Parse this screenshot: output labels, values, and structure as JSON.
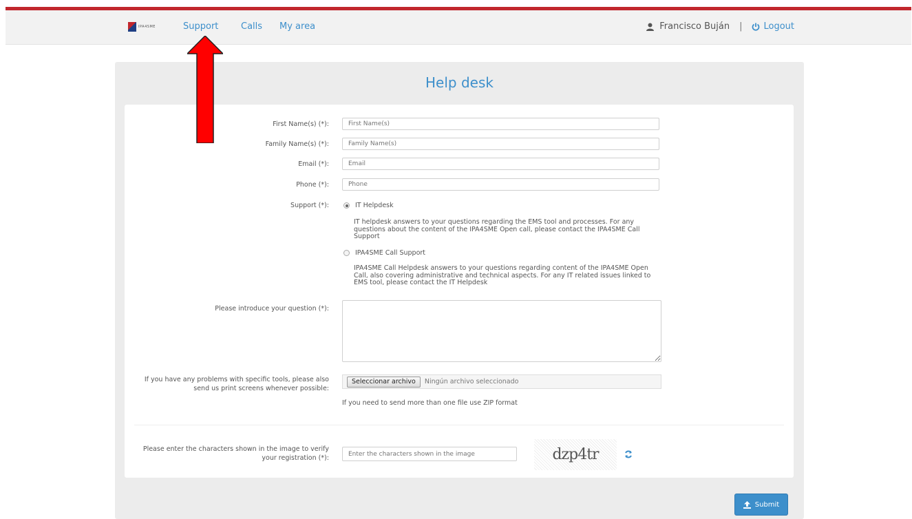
{
  "colors": {
    "accent": "#3d8fcb",
    "top_bar": "#c1272d",
    "arrow": "#ff0000"
  },
  "nav": {
    "logo_text": "IPA4SME",
    "links": [
      "Support",
      "Calls",
      "My area"
    ],
    "user_name": "Francisco Buján",
    "separator": "|",
    "logout_label": "Logout"
  },
  "page": {
    "title": "Help desk"
  },
  "form": {
    "first_name": {
      "label": "First Name(s) (*):",
      "placeholder": "First Name(s)"
    },
    "family_name": {
      "label": "Family Name(s) (*):",
      "placeholder": "Family Name(s)"
    },
    "email": {
      "label": "Email (*):",
      "placeholder": "Email"
    },
    "phone": {
      "label": "Phone (*):",
      "placeholder": "Phone"
    },
    "support": {
      "label": "Support (*):",
      "selected": "IT Helpdesk",
      "options": [
        {
          "label": "IT Helpdesk",
          "description": "IT helpdesk answers to your questions regarding the EMS tool and processes. For any questions about the content of the IPA4SME Open call, please contact the IPA4SME Call Support"
        },
        {
          "label": "IPA4SME Call Support",
          "description": "IPA4SME Call Helpdesk answers to your questions regarding content of the IPA4SME Open Call, also covering administrative and technical aspects. For any IT related issues linked to EMS tool, please contact the IT Helpdesk"
        }
      ]
    },
    "question": {
      "label": "Please introduce your question (*):",
      "value": ""
    },
    "file": {
      "label_line1": "If you have any problems with specific tools, please also",
      "label_line2": "send us print screens whenever possible:",
      "button_label": "Seleccionar archivo",
      "status": "Ningún archivo seleccionado",
      "hint": "If you need to send more than one file use ZIP format"
    },
    "captcha": {
      "label_line1": "Please enter the characters shown in the image to verify",
      "label_line2": "your registration (*):",
      "placeholder": "Enter the characters shown in the image",
      "image_text": "dzp4tr"
    }
  },
  "submit_label": "Submit"
}
